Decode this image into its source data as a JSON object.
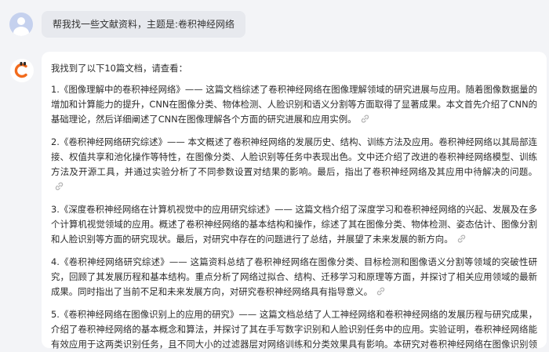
{
  "user_message": {
    "avatar_icon": "user-avatar-icon",
    "text": "帮我找一些文献资料，主题是:卷积神经网络"
  },
  "assistant_message": {
    "avatar_icon": "assistant-logo-icon",
    "accent_color": "#f26b1d",
    "intro": "我找到了以下10篇文档，请查看：",
    "link_icon": "link-icon",
    "references": [
      {
        "text": "1.《图像理解中的卷积神经网络》—— 这篇文档综述了卷积神经网络在图像理解领域的研究进展与应用。随着图像数据量的增加和计算能力的提升，CNN在图像分类、物体检测、人脸识别和语义分割等方面取得了显著成果。本文首先介绍了CNN的基础理论，然后详细阐述了CNN在图像理解各个方面的研究进展和应用实例。"
      },
      {
        "text": "2.《卷积神经网络研究综述》—— 本文概述了卷积神经网络的发展历史、结构、训练方法及应用。卷积神经网络以其局部连接、权值共享和池化操作等特性，在图像分类、人脸识别等任务中表现出色。文中还介绍了改进的卷积神经网络模型、训练方法及开源工具，并通过实验分析了不同参数设置对结果的影响。最后，指出了卷积神经网络及其应用中待解决的问题。"
      },
      {
        "text": "3.《深度卷积神经网络在计算机视觉中的应用研究综述》—— 这篇文档介绍了深度学习和卷积神经网络的兴起、发展及在多个计算机视觉领域的应用。概述了卷积神经网络的基本结构和操作，综述了其在图像分类、物体检测、姿态估计、图像分割和人脸识别等方面的研究现状。最后，对研究中存在的问题进行了总结，并展望了未来发展的新方向。"
      },
      {
        "text": "4.《卷积神经网络研究综述》—— 这篇资料总结了卷积神经网络在图像分类、目标检测和图像语义分割等领域的突破性研究，回顾了其发展历程和基本结构。重点分析了网络过拟合、结构、迁移学习和原理等方面，并探讨了相关应用领域的最新成果。同时指出了当前不足和未来发展方向，对研究卷积神经网络具有指导意义。"
      },
      {
        "text": "5.《卷积神经网络在图像识别上的应用的研究》—— 这篇文档总结了人工神经网络和卷积神经网络的发展历程与研究成果，介绍了卷积神经网络的基本概念和算法，并探讨了其在手写数字识别和人脸识别任务中的应用。实验证明，卷积神经网络能有效应用于这两类识别任务，且不同大小的过滤器层对网络训练和分类效果具有影响。本研究对卷积神经网络在图像识别领域的应用具有重要价值。"
      }
    ]
  }
}
